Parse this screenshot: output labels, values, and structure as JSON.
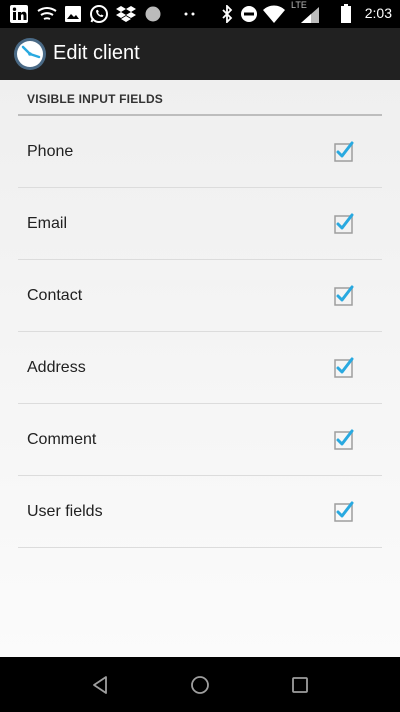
{
  "status_bar": {
    "time": "2:03",
    "network": "LTE",
    "icons": [
      "linkedin-icon",
      "signal-wave-icon",
      "image-icon",
      "whatsapp-icon",
      "dropbox-icon",
      "circle-icon",
      "dots-icon",
      "bluetooth-icon",
      "do-not-disturb-icon",
      "wifi-icon",
      "cell-signal-icon",
      "battery-icon"
    ]
  },
  "app_bar": {
    "title": "Edit client",
    "icon": "clock-icon"
  },
  "section": {
    "header": "VISIBLE INPUT FIELDS",
    "items": [
      {
        "label": "Phone",
        "checked": true
      },
      {
        "label": "Email",
        "checked": true
      },
      {
        "label": "Contact",
        "checked": true
      },
      {
        "label": "Address",
        "checked": true
      },
      {
        "label": "Comment",
        "checked": true
      },
      {
        "label": "User fields",
        "checked": true
      }
    ]
  },
  "nav_bar": {
    "icons": [
      "back-icon",
      "home-icon",
      "recents-icon"
    ]
  },
  "colors": {
    "accent": "#29a9e0",
    "app_bar": "#212121"
  }
}
